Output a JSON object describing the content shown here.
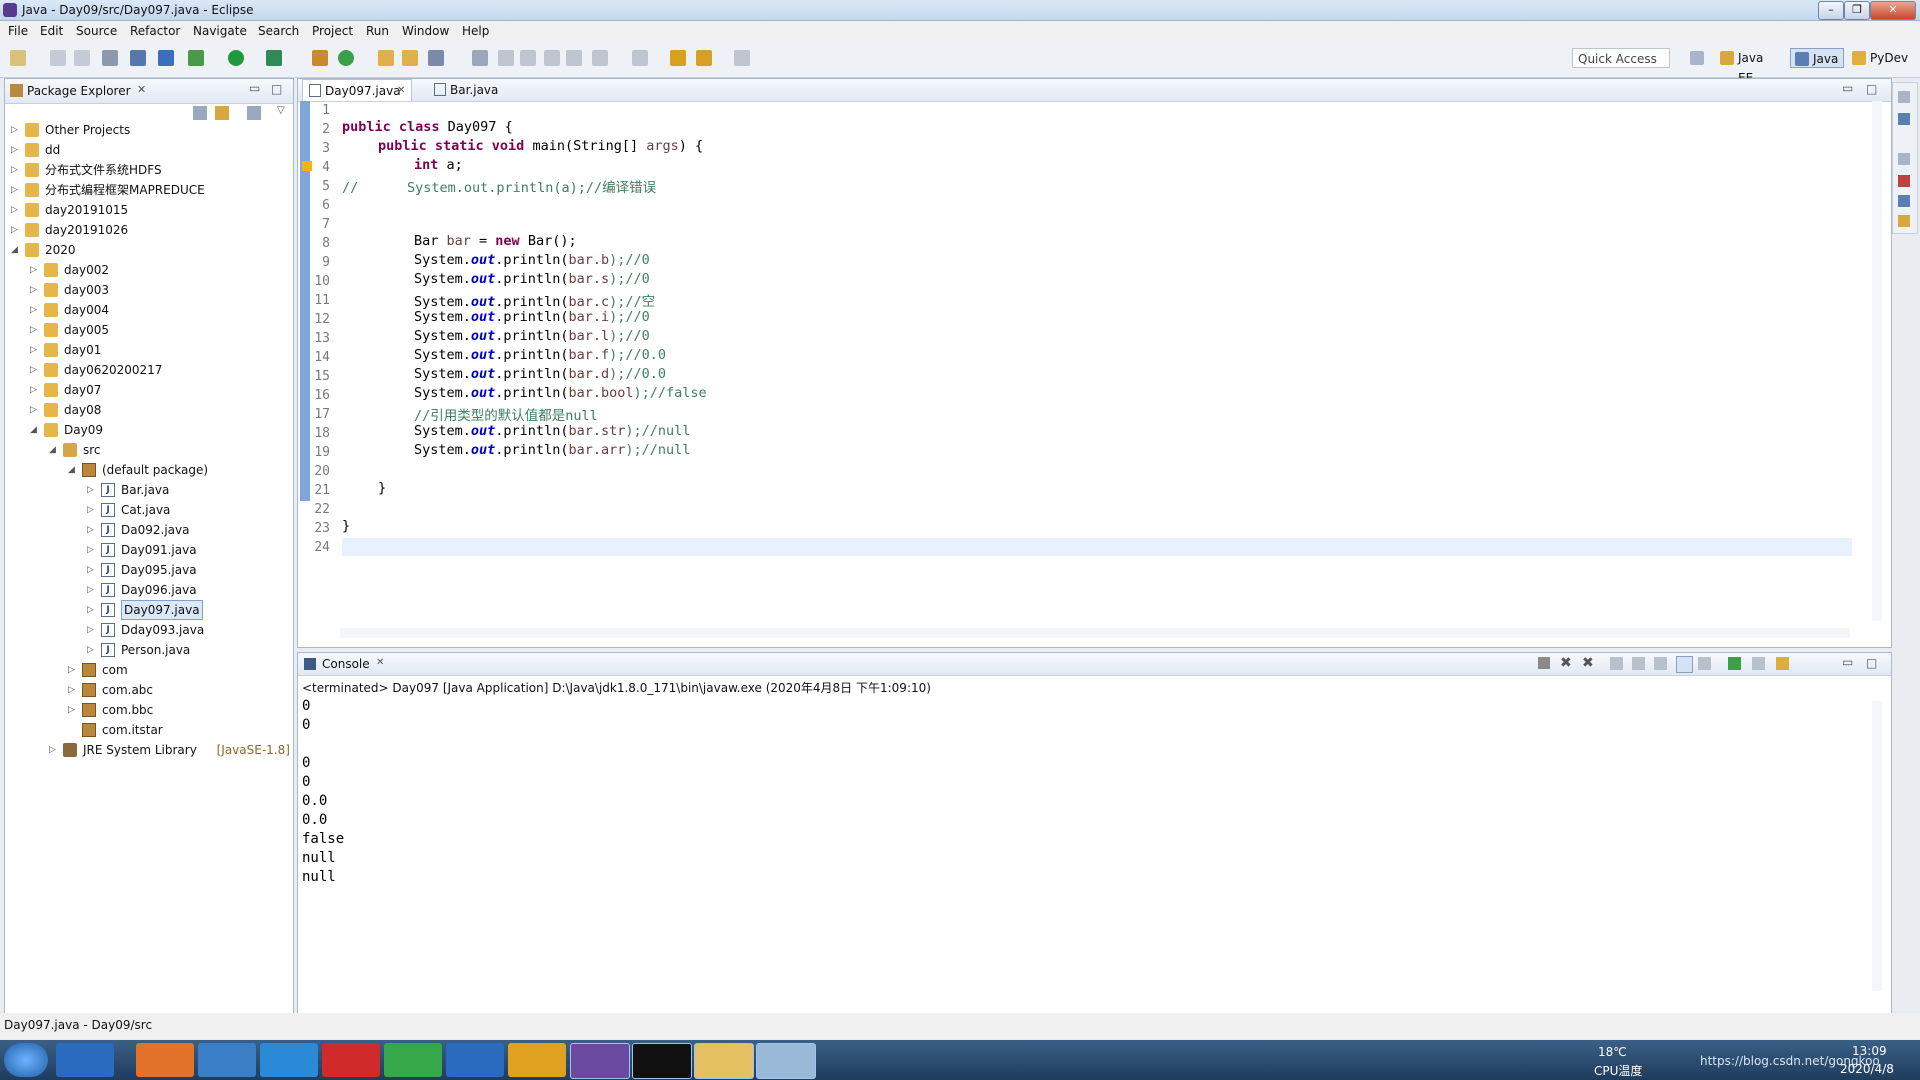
{
  "window": {
    "title": "Java - Day09/src/Day097.java - Eclipse",
    "min": "–",
    "max": "❐",
    "close": "✕"
  },
  "menu": [
    "File",
    "Edit",
    "Source",
    "Refactor",
    "Navigate",
    "Search",
    "Project",
    "Run",
    "Window",
    "Help"
  ],
  "toolbar": {
    "quick_access": "Quick Access",
    "perspectives": [
      "Java EE",
      "Java",
      "PyDev"
    ]
  },
  "package_explorer": {
    "title": "Package Explorer",
    "items": [
      {
        "label": "Other Projects",
        "depth": 0,
        "kind": "proj",
        "arrow": "▷"
      },
      {
        "label": "dd",
        "depth": 0,
        "kind": "proj",
        "arrow": "▷"
      },
      {
        "label": "分布式文件系统HDFS",
        "depth": 0,
        "kind": "proj",
        "arrow": "▷"
      },
      {
        "label": "分布式编程框架MAPREDUCE",
        "depth": 0,
        "kind": "proj",
        "arrow": "▷"
      },
      {
        "label": "day20191015",
        "depth": 0,
        "kind": "proj",
        "arrow": "▷"
      },
      {
        "label": "day20191026",
        "depth": 0,
        "kind": "proj",
        "arrow": "▷"
      },
      {
        "label": "2020",
        "depth": 0,
        "kind": "proj",
        "arrow": "◢"
      },
      {
        "label": "day002",
        "depth": 1,
        "kind": "proj",
        "arrow": "▷"
      },
      {
        "label": "day003",
        "depth": 1,
        "kind": "proj",
        "arrow": "▷"
      },
      {
        "label": "day004",
        "depth": 1,
        "kind": "proj",
        "arrow": "▷"
      },
      {
        "label": "day005",
        "depth": 1,
        "kind": "proj",
        "arrow": "▷"
      },
      {
        "label": "day01",
        "depth": 1,
        "kind": "proj",
        "arrow": "▷"
      },
      {
        "label": "day0620200217",
        "depth": 1,
        "kind": "proj",
        "arrow": "▷"
      },
      {
        "label": "day07",
        "depth": 1,
        "kind": "proj",
        "arrow": "▷"
      },
      {
        "label": "day08",
        "depth": 1,
        "kind": "proj",
        "arrow": "▷"
      },
      {
        "label": "Day09",
        "depth": 1,
        "kind": "proj",
        "arrow": "◢"
      },
      {
        "label": "src",
        "depth": 2,
        "kind": "src",
        "arrow": "◢"
      },
      {
        "label": "(default package)",
        "depth": 3,
        "kind": "pkg",
        "arrow": "◢"
      },
      {
        "label": "Bar.java",
        "depth": 4,
        "kind": "java",
        "arrow": "▷"
      },
      {
        "label": "Cat.java",
        "depth": 4,
        "kind": "java",
        "arrow": "▷"
      },
      {
        "label": "Da092.java",
        "depth": 4,
        "kind": "java",
        "arrow": "▷"
      },
      {
        "label": "Day091.java",
        "depth": 4,
        "kind": "java",
        "arrow": "▷"
      },
      {
        "label": "Day095.java",
        "depth": 4,
        "kind": "java",
        "arrow": "▷"
      },
      {
        "label": "Day096.java",
        "depth": 4,
        "kind": "java",
        "arrow": "▷"
      },
      {
        "label": "Day097.java",
        "depth": 4,
        "kind": "java",
        "arrow": "▷",
        "selected": true
      },
      {
        "label": "Dday093.java",
        "depth": 4,
        "kind": "java",
        "arrow": "▷"
      },
      {
        "label": "Person.java",
        "depth": 4,
        "kind": "java",
        "arrow": "▷"
      },
      {
        "label": "com",
        "depth": 3,
        "kind": "pkg",
        "arrow": "▷"
      },
      {
        "label": "com.abc",
        "depth": 3,
        "kind": "pkg",
        "arrow": "▷"
      },
      {
        "label": "com.bbc",
        "depth": 3,
        "kind": "pkg",
        "arrow": "▷"
      },
      {
        "label": "com.itstar",
        "depth": 3,
        "kind": "pkg",
        "arrow": ""
      },
      {
        "label": "JRE System Library",
        "suffix": "[JavaSE-1.8]",
        "depth": 2,
        "kind": "jre",
        "arrow": "▷"
      }
    ]
  },
  "editor": {
    "tabs": [
      "Day097.java",
      "Bar.java"
    ],
    "lines": [
      "1",
      "2",
      "3",
      "4",
      "5",
      "6",
      "7",
      "8",
      "9",
      "10",
      "11",
      "12",
      "13",
      "14",
      "15",
      "16",
      "17",
      "18",
      "19",
      "20",
      "21",
      "22",
      "23",
      "24"
    ],
    "code": {
      "l2a": "public class",
      "l2b": " Day097 {",
      "l3a": "public static void",
      "l3b": " main(String[] ",
      "l3c": "args",
      "l3d": ") {",
      "l4a": "int",
      "l4b": " a;",
      "l5": "//      System.out.println(a);//编译错误",
      "l8a": "Bar ",
      "l8b": "bar",
      "l8c": " = ",
      "l8d": "new",
      "l8e": " Bar();",
      "sys": "System.",
      "out": "out",
      "pre": ".println(",
      "b": "bar.b",
      "s": "bar.s",
      "c": "bar.c",
      "i": "bar.i",
      "l": "bar.l",
      "f": "bar.f",
      "d": "bar.d",
      "bool": "bar.bool",
      "str": "bar.str",
      "arr": "bar.arr",
      "c0": ");//0",
      "c空": ");//空",
      "c00": ");//0.0",
      "cfalse": ");//false",
      "cnull": ");//null",
      "l17": "//引用类型的默认值都是null",
      "l21": "}",
      "l23": "}"
    }
  },
  "console": {
    "title": "Console",
    "header": "<terminated> Day097 [Java Application] D:\\Java\\jdk1.8.0_171\\bin\\javaw.exe (2020年4月8日 下午1:09:10)",
    "output": [
      "0",
      "0",
      "",
      "0",
      "0",
      "0.0",
      "0.0",
      "false",
      "null",
      "null"
    ]
  },
  "status": {
    "text": "Day097.java - Day09/src"
  },
  "taskbar": {
    "temp": "18℃",
    "cpu": "CPU温度",
    "time": "13:09",
    "date": "2020/4/8",
    "watermark": "https://blog.csdn.net/gongkoo"
  }
}
